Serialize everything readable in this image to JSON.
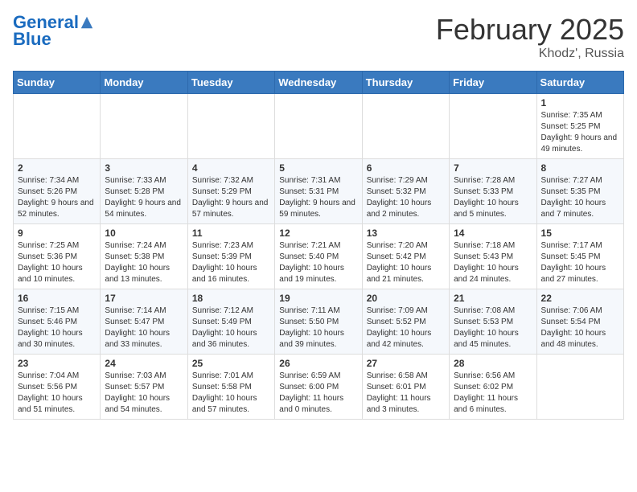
{
  "header": {
    "logo_line1": "General",
    "logo_line2": "Blue",
    "month": "February 2025",
    "location": "Khodz', Russia"
  },
  "weekdays": [
    "Sunday",
    "Monday",
    "Tuesday",
    "Wednesday",
    "Thursday",
    "Friday",
    "Saturday"
  ],
  "weeks": [
    [
      {
        "day": "",
        "info": ""
      },
      {
        "day": "",
        "info": ""
      },
      {
        "day": "",
        "info": ""
      },
      {
        "day": "",
        "info": ""
      },
      {
        "day": "",
        "info": ""
      },
      {
        "day": "",
        "info": ""
      },
      {
        "day": "1",
        "info": "Sunrise: 7:35 AM\nSunset: 5:25 PM\nDaylight: 9 hours and 49 minutes."
      }
    ],
    [
      {
        "day": "2",
        "info": "Sunrise: 7:34 AM\nSunset: 5:26 PM\nDaylight: 9 hours and 52 minutes."
      },
      {
        "day": "3",
        "info": "Sunrise: 7:33 AM\nSunset: 5:28 PM\nDaylight: 9 hours and 54 minutes."
      },
      {
        "day": "4",
        "info": "Sunrise: 7:32 AM\nSunset: 5:29 PM\nDaylight: 9 hours and 57 minutes."
      },
      {
        "day": "5",
        "info": "Sunrise: 7:31 AM\nSunset: 5:31 PM\nDaylight: 9 hours and 59 minutes."
      },
      {
        "day": "6",
        "info": "Sunrise: 7:29 AM\nSunset: 5:32 PM\nDaylight: 10 hours and 2 minutes."
      },
      {
        "day": "7",
        "info": "Sunrise: 7:28 AM\nSunset: 5:33 PM\nDaylight: 10 hours and 5 minutes."
      },
      {
        "day": "8",
        "info": "Sunrise: 7:27 AM\nSunset: 5:35 PM\nDaylight: 10 hours and 7 minutes."
      }
    ],
    [
      {
        "day": "9",
        "info": "Sunrise: 7:25 AM\nSunset: 5:36 PM\nDaylight: 10 hours and 10 minutes."
      },
      {
        "day": "10",
        "info": "Sunrise: 7:24 AM\nSunset: 5:38 PM\nDaylight: 10 hours and 13 minutes."
      },
      {
        "day": "11",
        "info": "Sunrise: 7:23 AM\nSunset: 5:39 PM\nDaylight: 10 hours and 16 minutes."
      },
      {
        "day": "12",
        "info": "Sunrise: 7:21 AM\nSunset: 5:40 PM\nDaylight: 10 hours and 19 minutes."
      },
      {
        "day": "13",
        "info": "Sunrise: 7:20 AM\nSunset: 5:42 PM\nDaylight: 10 hours and 21 minutes."
      },
      {
        "day": "14",
        "info": "Sunrise: 7:18 AM\nSunset: 5:43 PM\nDaylight: 10 hours and 24 minutes."
      },
      {
        "day": "15",
        "info": "Sunrise: 7:17 AM\nSunset: 5:45 PM\nDaylight: 10 hours and 27 minutes."
      }
    ],
    [
      {
        "day": "16",
        "info": "Sunrise: 7:15 AM\nSunset: 5:46 PM\nDaylight: 10 hours and 30 minutes."
      },
      {
        "day": "17",
        "info": "Sunrise: 7:14 AM\nSunset: 5:47 PM\nDaylight: 10 hours and 33 minutes."
      },
      {
        "day": "18",
        "info": "Sunrise: 7:12 AM\nSunset: 5:49 PM\nDaylight: 10 hours and 36 minutes."
      },
      {
        "day": "19",
        "info": "Sunrise: 7:11 AM\nSunset: 5:50 PM\nDaylight: 10 hours and 39 minutes."
      },
      {
        "day": "20",
        "info": "Sunrise: 7:09 AM\nSunset: 5:52 PM\nDaylight: 10 hours and 42 minutes."
      },
      {
        "day": "21",
        "info": "Sunrise: 7:08 AM\nSunset: 5:53 PM\nDaylight: 10 hours and 45 minutes."
      },
      {
        "day": "22",
        "info": "Sunrise: 7:06 AM\nSunset: 5:54 PM\nDaylight: 10 hours and 48 minutes."
      }
    ],
    [
      {
        "day": "23",
        "info": "Sunrise: 7:04 AM\nSunset: 5:56 PM\nDaylight: 10 hours and 51 minutes."
      },
      {
        "day": "24",
        "info": "Sunrise: 7:03 AM\nSunset: 5:57 PM\nDaylight: 10 hours and 54 minutes."
      },
      {
        "day": "25",
        "info": "Sunrise: 7:01 AM\nSunset: 5:58 PM\nDaylight: 10 hours and 57 minutes."
      },
      {
        "day": "26",
        "info": "Sunrise: 6:59 AM\nSunset: 6:00 PM\nDaylight: 11 hours and 0 minutes."
      },
      {
        "day": "27",
        "info": "Sunrise: 6:58 AM\nSunset: 6:01 PM\nDaylight: 11 hours and 3 minutes."
      },
      {
        "day": "28",
        "info": "Sunrise: 6:56 AM\nSunset: 6:02 PM\nDaylight: 11 hours and 6 minutes."
      },
      {
        "day": "",
        "info": ""
      }
    ]
  ]
}
